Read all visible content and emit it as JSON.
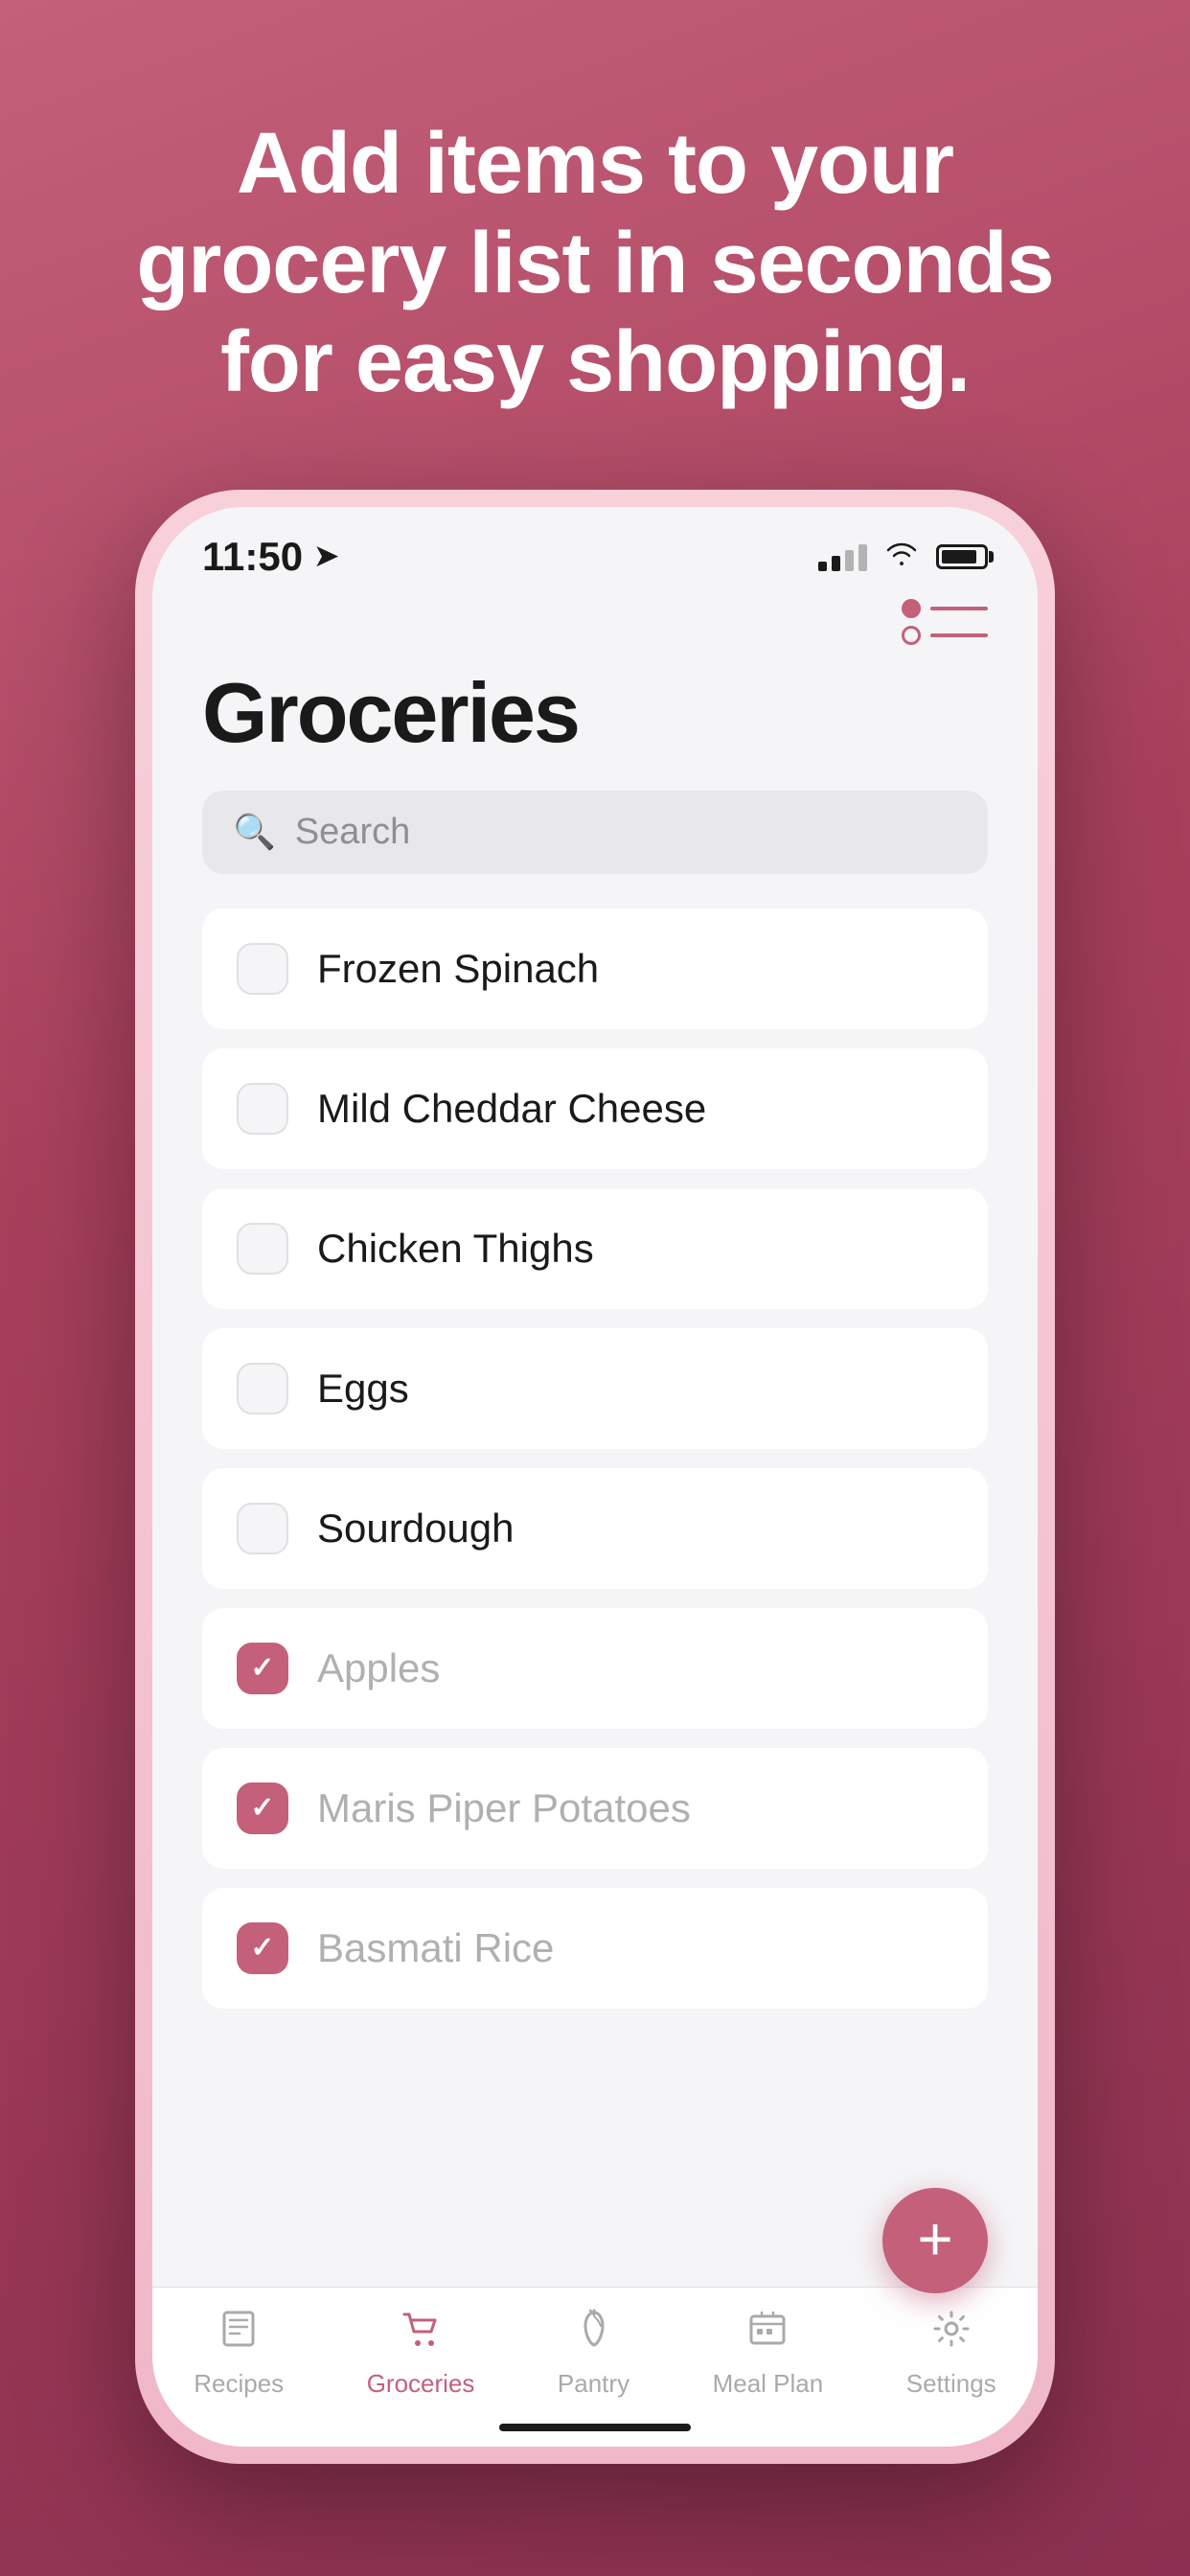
{
  "hero": {
    "title": "Add items to your grocery list in seconds for easy shopping."
  },
  "status_bar": {
    "time": "11:50",
    "nav_arrow": "➤"
  },
  "top_bar": {
    "filter_icon_label": "filter-icon"
  },
  "page": {
    "title": "Groceries"
  },
  "search": {
    "placeholder": "Search"
  },
  "grocery_items": [
    {
      "id": 1,
      "label": "Frozen Spinach",
      "checked": false
    },
    {
      "id": 2,
      "label": "Mild Cheddar Cheese",
      "checked": false
    },
    {
      "id": 3,
      "label": "Chicken Thighs",
      "checked": false
    },
    {
      "id": 4,
      "label": "Eggs",
      "checked": false
    },
    {
      "id": 5,
      "label": "Sourdough",
      "checked": false
    },
    {
      "id": 6,
      "label": "Apples",
      "checked": true
    },
    {
      "id": 7,
      "label": "Maris Piper Potatoes",
      "checked": true
    },
    {
      "id": 8,
      "label": "Basmati Rice",
      "checked": true
    }
  ],
  "fab": {
    "label": "+"
  },
  "tabs": [
    {
      "id": "recipes",
      "label": "Recipes",
      "icon": "📋",
      "active": false
    },
    {
      "id": "groceries",
      "label": "Groceries",
      "icon": "🛒",
      "active": true
    },
    {
      "id": "pantry",
      "label": "Pantry",
      "icon": "🥕",
      "active": false
    },
    {
      "id": "meal-plan",
      "label": "Meal Plan",
      "icon": "📅",
      "active": false
    },
    {
      "id": "settings",
      "label": "Settings",
      "icon": "⚙️",
      "active": false
    }
  ]
}
